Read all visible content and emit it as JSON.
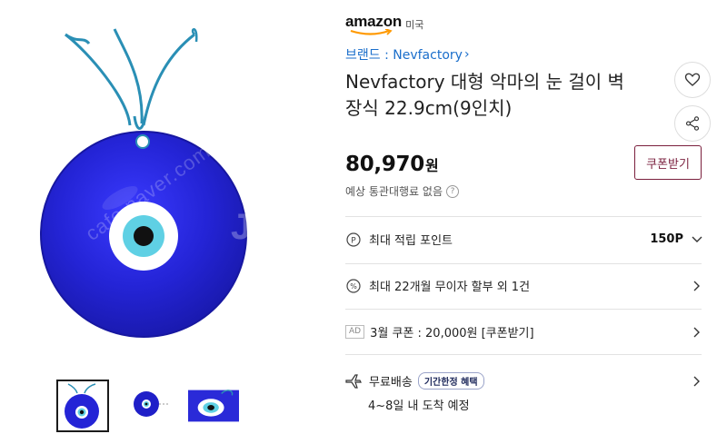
{
  "store": {
    "logo_text": "amazon",
    "region": "미국"
  },
  "product": {
    "brand_label": "브랜드 : Nevfactory",
    "brand_chevron": "›",
    "title": "Nevfactory 대형 악마의 눈 걸이 벽 장식 22.9cm(9인치)",
    "price": "80,970",
    "currency": "원",
    "customs_note": "예상 통관대행료 없음",
    "help_glyph": "?"
  },
  "actions": {
    "coupon_button": "쿠폰받기",
    "heart_icon": "heart-icon",
    "share_icon": "share-icon"
  },
  "benefits": [
    {
      "icon": "point-icon",
      "label": "최대 적립 포인트",
      "value": "150P",
      "chevron": "down"
    },
    {
      "icon": "percent-icon",
      "label": "최대 22개월 무이자 할부 외 1건",
      "chevron": "right"
    },
    {
      "badge": "AD",
      "label": "3월 쿠폰 : 20,000원 [쿠폰받기]",
      "chevron": "right"
    },
    {
      "icon": "airplane-icon",
      "label": "무료배송",
      "tag": "기간한정 혜택",
      "sub": "4~8일 내 도착 예정",
      "chevron": "right"
    }
  ],
  "watermark": {
    "text": "cafe.naver.com/joonggonara",
    "mark": "Jo"
  },
  "colors": {
    "link": "#1a6ecb",
    "coupon_accent": "#7a1f3d",
    "eye_blue": "#2828d8",
    "eye_light": "#5fd0e4"
  }
}
